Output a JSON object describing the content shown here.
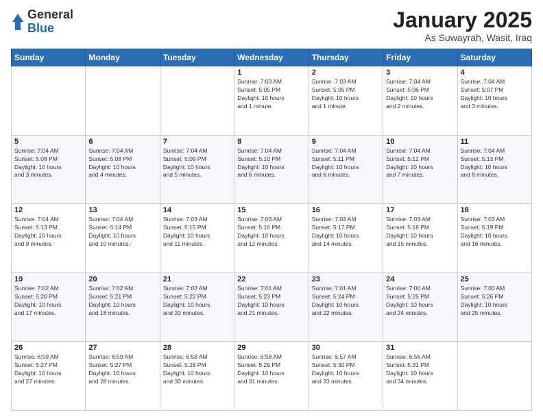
{
  "logo": {
    "general": "General",
    "blue": "Blue"
  },
  "header": {
    "title": "January 2025",
    "subtitle": "As Suwayrah, Wasit, Iraq"
  },
  "weekdays": [
    "Sunday",
    "Monday",
    "Tuesday",
    "Wednesday",
    "Thursday",
    "Friday",
    "Saturday"
  ],
  "weeks": [
    [
      {
        "day": "",
        "info": ""
      },
      {
        "day": "",
        "info": ""
      },
      {
        "day": "",
        "info": ""
      },
      {
        "day": "1",
        "info": "Sunrise: 7:03 AM\nSunset: 5:05 PM\nDaylight: 10 hours\nand 1 minute."
      },
      {
        "day": "2",
        "info": "Sunrise: 7:03 AM\nSunset: 5:05 PM\nDaylight: 10 hours\nand 1 minute."
      },
      {
        "day": "3",
        "info": "Sunrise: 7:04 AM\nSunset: 5:06 PM\nDaylight: 10 hours\nand 2 minutes."
      },
      {
        "day": "4",
        "info": "Sunrise: 7:04 AM\nSunset: 5:07 PM\nDaylight: 10 hours\nand 3 minutes."
      }
    ],
    [
      {
        "day": "5",
        "info": "Sunrise: 7:04 AM\nSunset: 5:08 PM\nDaylight: 10 hours\nand 3 minutes."
      },
      {
        "day": "6",
        "info": "Sunrise: 7:04 AM\nSunset: 5:08 PM\nDaylight: 10 hours\nand 4 minutes."
      },
      {
        "day": "7",
        "info": "Sunrise: 7:04 AM\nSunset: 5:09 PM\nDaylight: 10 hours\nand 5 minutes."
      },
      {
        "day": "8",
        "info": "Sunrise: 7:04 AM\nSunset: 5:10 PM\nDaylight: 10 hours\nand 6 minutes."
      },
      {
        "day": "9",
        "info": "Sunrise: 7:04 AM\nSunset: 5:11 PM\nDaylight: 10 hours\nand 6 minutes."
      },
      {
        "day": "10",
        "info": "Sunrise: 7:04 AM\nSunset: 5:12 PM\nDaylight: 10 hours\nand 7 minutes."
      },
      {
        "day": "11",
        "info": "Sunrise: 7:04 AM\nSunset: 5:13 PM\nDaylight: 10 hours\nand 8 minutes."
      }
    ],
    [
      {
        "day": "12",
        "info": "Sunrise: 7:04 AM\nSunset: 5:13 PM\nDaylight: 10 hours\nand 9 minutes."
      },
      {
        "day": "13",
        "info": "Sunrise: 7:04 AM\nSunset: 5:14 PM\nDaylight: 10 hours\nand 10 minutes."
      },
      {
        "day": "14",
        "info": "Sunrise: 7:03 AM\nSunset: 5:15 PM\nDaylight: 10 hours\nand 11 minutes."
      },
      {
        "day": "15",
        "info": "Sunrise: 7:03 AM\nSunset: 5:16 PM\nDaylight: 10 hours\nand 12 minutes."
      },
      {
        "day": "16",
        "info": "Sunrise: 7:03 AM\nSunset: 5:17 PM\nDaylight: 10 hours\nand 14 minutes."
      },
      {
        "day": "17",
        "info": "Sunrise: 7:03 AM\nSunset: 5:18 PM\nDaylight: 10 hours\nand 15 minutes."
      },
      {
        "day": "18",
        "info": "Sunrise: 7:03 AM\nSunset: 5:19 PM\nDaylight: 10 hours\nand 16 minutes."
      }
    ],
    [
      {
        "day": "19",
        "info": "Sunrise: 7:02 AM\nSunset: 5:20 PM\nDaylight: 10 hours\nand 17 minutes."
      },
      {
        "day": "20",
        "info": "Sunrise: 7:02 AM\nSunset: 5:21 PM\nDaylight: 10 hours\nand 18 minutes."
      },
      {
        "day": "21",
        "info": "Sunrise: 7:02 AM\nSunset: 5:22 PM\nDaylight: 10 hours\nand 20 minutes."
      },
      {
        "day": "22",
        "info": "Sunrise: 7:01 AM\nSunset: 5:23 PM\nDaylight: 10 hours\nand 21 minutes."
      },
      {
        "day": "23",
        "info": "Sunrise: 7:01 AM\nSunset: 5:24 PM\nDaylight: 10 hours\nand 22 minutes."
      },
      {
        "day": "24",
        "info": "Sunrise: 7:00 AM\nSunset: 5:25 PM\nDaylight: 10 hours\nand 24 minutes."
      },
      {
        "day": "25",
        "info": "Sunrise: 7:00 AM\nSunset: 5:26 PM\nDaylight: 10 hours\nand 25 minutes."
      }
    ],
    [
      {
        "day": "26",
        "info": "Sunrise: 6:59 AM\nSunset: 5:27 PM\nDaylight: 10 hours\nand 27 minutes."
      },
      {
        "day": "27",
        "info": "Sunrise: 6:59 AM\nSunset: 5:27 PM\nDaylight: 10 hours\nand 28 minutes."
      },
      {
        "day": "28",
        "info": "Sunrise: 6:58 AM\nSunset: 5:28 PM\nDaylight: 10 hours\nand 30 minutes."
      },
      {
        "day": "29",
        "info": "Sunrise: 6:58 AM\nSunset: 5:29 PM\nDaylight: 10 hours\nand 31 minutes."
      },
      {
        "day": "30",
        "info": "Sunrise: 6:57 AM\nSunset: 5:30 PM\nDaylight: 10 hours\nand 33 minutes."
      },
      {
        "day": "31",
        "info": "Sunrise: 6:56 AM\nSunset: 5:31 PM\nDaylight: 10 hours\nand 34 minutes."
      },
      {
        "day": "",
        "info": ""
      }
    ]
  ]
}
